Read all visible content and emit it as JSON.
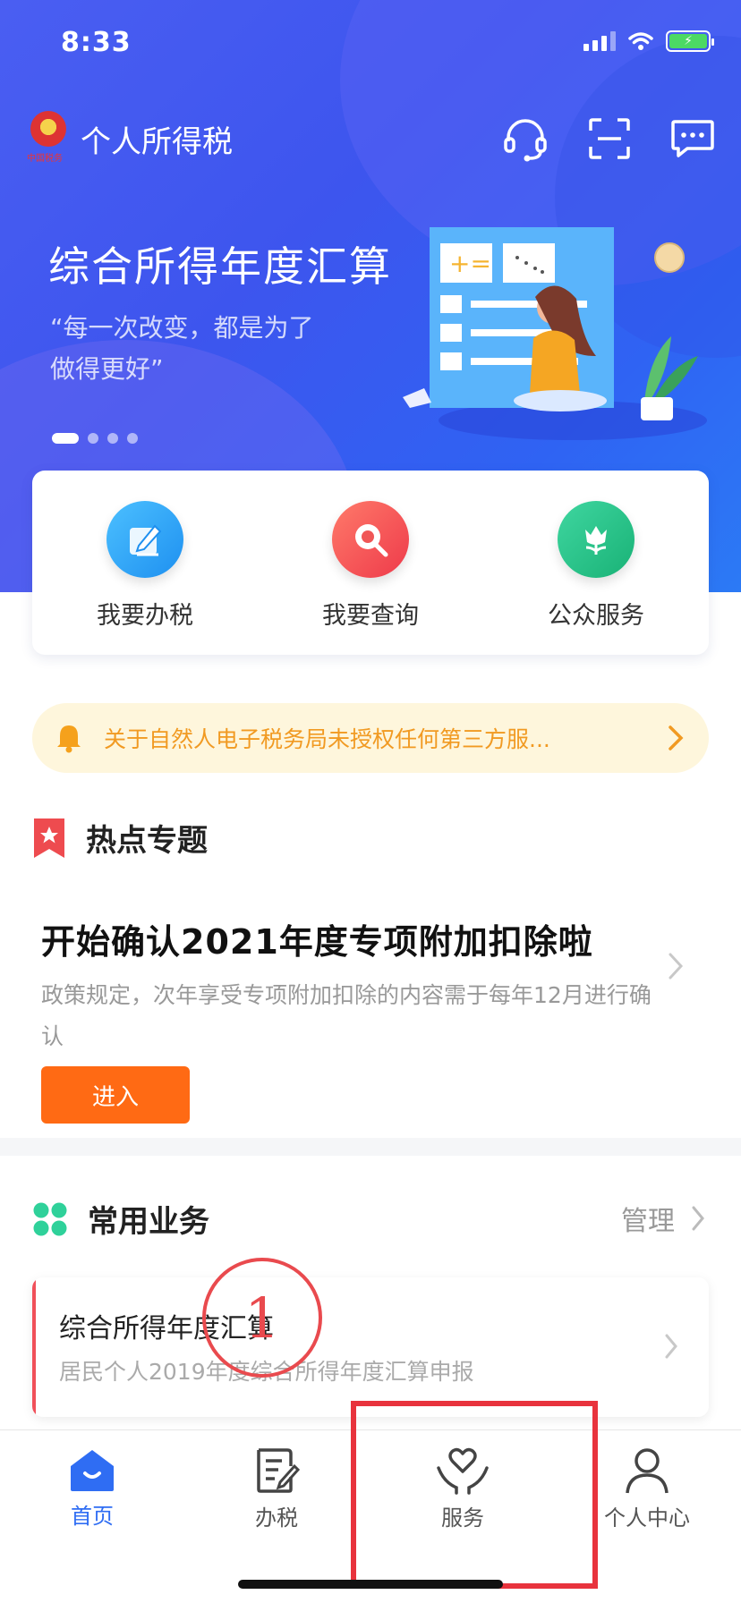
{
  "status_bar": {
    "time": "8:33"
  },
  "header": {
    "app_title": "个人所得税",
    "emblem_text": "中国税务"
  },
  "banner": {
    "title": "综合所得年度汇算",
    "subtitle_line1": "“每一次改变，都是为了",
    "subtitle_line2": "做得更好”",
    "pages": 4,
    "active_page": 1
  },
  "quick_actions": [
    {
      "label": "我要办税",
      "icon": "edit-icon",
      "color": "#2aa8f2"
    },
    {
      "label": "我要查询",
      "icon": "search-icon",
      "color": "#f34a4a"
    },
    {
      "label": "公众服务",
      "icon": "tulip-icon",
      "color": "#27c08a"
    }
  ],
  "notice": {
    "text": "关于自然人电子税务局未授权任何第三方服..."
  },
  "hot_topic": {
    "section_title": "热点专题",
    "title": "开始确认2021年度专项附加扣除啦",
    "desc": "政策规定，次年享受专项附加扣除的内容需于每年12月进行确认",
    "enter_label": "进入"
  },
  "common_business": {
    "section_title": "常用业务",
    "manage_label": "管理",
    "items": [
      {
        "title": "综合所得年度汇算",
        "subtitle": "居民个人2019年度综合所得年度汇算申报"
      }
    ]
  },
  "annotation": {
    "step_number": "1"
  },
  "tab_bar": {
    "tabs": [
      {
        "label": "首页",
        "icon": "home-icon",
        "active": true
      },
      {
        "label": "办税",
        "icon": "document-icon",
        "active": false
      },
      {
        "label": "服务",
        "icon": "heart-hands-icon",
        "active": false
      },
      {
        "label": "个人中心",
        "icon": "person-icon",
        "active": false
      }
    ]
  },
  "colors": {
    "brand_blue": "#2f6df3",
    "accent_orange": "#ff6a14",
    "notice_text": "#f19a22",
    "annotation_red": "#e8333d"
  }
}
